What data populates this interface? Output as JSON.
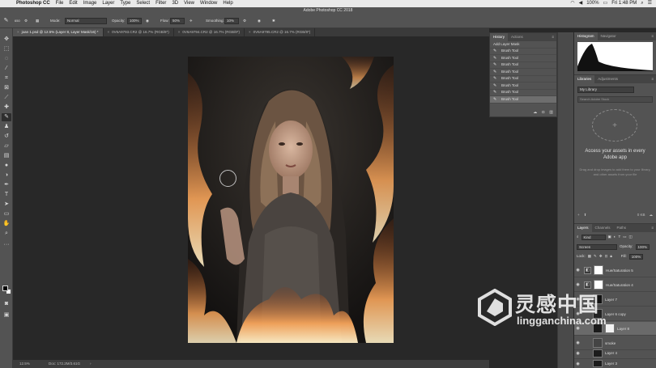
{
  "menubar": {
    "app_name": "Photoshop CC",
    "items": [
      "File",
      "Edit",
      "Image",
      "Layer",
      "Type",
      "Select",
      "Filter",
      "3D",
      "View",
      "Window",
      "Help"
    ],
    "battery": "100%",
    "clock": "Fri 1:48 PM"
  },
  "window_title": "Adobe Photoshop CC 2018",
  "options": {
    "brush_size": "650",
    "mode_label": "Mode:",
    "mode_value": "Normal",
    "opacity_label": "Opacity:",
    "opacity_value": "100%",
    "flow_label": "Flow:",
    "flow_value": "50%",
    "smoothing_label": "Smoothing:",
    "smoothing_value": "10%"
  },
  "tabs": [
    {
      "label": "joan 1.psd @ 12.5% (Layer 8, Layer Mask/16) *",
      "active": true
    },
    {
      "label": "0V6A9793.CR2 @ 16.7% (RGB/8*)",
      "active": false
    },
    {
      "label": "0V6A9794.CR2 @ 16.7% (RGB/8*)",
      "active": false
    },
    {
      "label": "0V6A9795.CR2 @ 16.7% (RGB/8*)",
      "active": false
    }
  ],
  "status": {
    "zoom": "12.5%",
    "doc": "Doc: 172.2M/3.61G"
  },
  "history": {
    "tab_history": "History",
    "tab_actions": "Actions",
    "items": [
      {
        "label": "Add Layer Mask",
        "selected": false
      },
      {
        "label": "Brush Tool",
        "selected": false
      },
      {
        "label": "Brush Tool",
        "selected": false
      },
      {
        "label": "Brush Tool",
        "selected": false
      },
      {
        "label": "Brush Tool",
        "selected": false
      },
      {
        "label": "Brush Tool",
        "selected": false
      },
      {
        "label": "Brush Tool",
        "selected": false
      },
      {
        "label": "Brush Tool",
        "selected": false
      },
      {
        "label": "Brush Tool",
        "selected": true
      }
    ]
  },
  "histogram": {
    "tab_histogram": "Histogram",
    "tab_navigator": "Navigator"
  },
  "libraries": {
    "tab_libraries": "Libraries",
    "tab_adjustments": "Adjustments",
    "library_select": "My Library",
    "search_placeholder": "Search Adobe Stock",
    "title": "Access your assets in every Adobe app",
    "description": "Drag and drop images to add them to your library, and other assets from your file",
    "size": "0 KB"
  },
  "layers": {
    "tab_layers": "Layers",
    "tab_channels": "Channels",
    "tab_paths": "Paths",
    "kind_label": "Kind",
    "blend_mode": "Screen",
    "opacity_label": "Opacity:",
    "opacity_value": "100%",
    "lock_label": "Lock:",
    "fill_label": "Fill:",
    "fill_value": "100%",
    "items": [
      {
        "name": "Hue/Saturation 5",
        "type": "adjustment",
        "selected": false
      },
      {
        "name": "Hue/Saturation 4",
        "type": "adjustment",
        "selected": false
      },
      {
        "name": "Layer 7",
        "type": "pixel",
        "selected": false
      },
      {
        "name": "Layer 6 copy",
        "type": "pixel",
        "selected": false
      },
      {
        "name": "Layer 8",
        "type": "pixel",
        "selected": true
      },
      {
        "name": "smoke",
        "type": "pixel",
        "selected": false
      },
      {
        "name": "Layer 4",
        "type": "pixel",
        "selected": false
      },
      {
        "name": "Layer 3",
        "type": "pixel",
        "selected": false
      }
    ]
  },
  "watermark": {
    "chinese": "灵感中国",
    "url": "lingganchina.com"
  },
  "colors": {
    "panel_bg": "#535353",
    "canvas_bg": "#282828",
    "fire": "#f08a3a"
  }
}
